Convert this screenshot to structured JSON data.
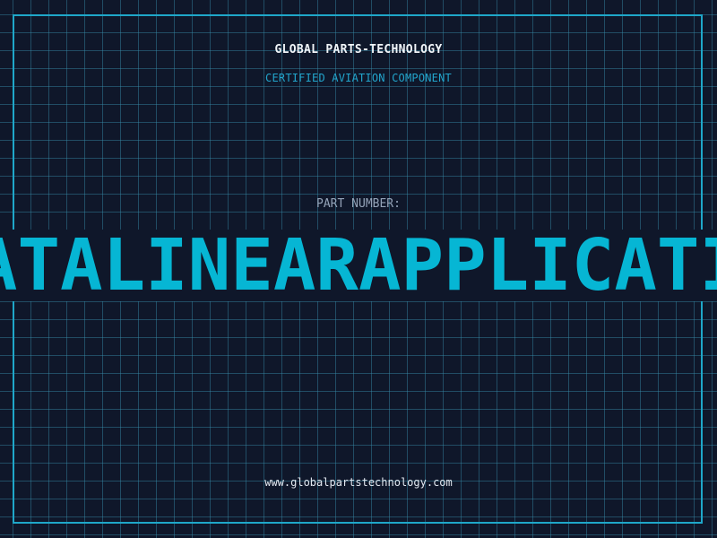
{
  "header": {
    "brand": "GLOBAL PARTS-TECHNOLOGY",
    "tagline": "CERTIFIED AVIATION COMPONENT"
  },
  "part": {
    "label": "PART NUMBER:",
    "number": "DATALINEARAPPLICATIO"
  },
  "footer": {
    "url": "www.globalpartstechnology.com"
  },
  "colors": {
    "background": "#0f172a",
    "grid": "#388caa",
    "frame": "#1fa7c9",
    "accent": "#06b6d4",
    "muted": "#94a3b8",
    "text": "#f1f5f9"
  }
}
